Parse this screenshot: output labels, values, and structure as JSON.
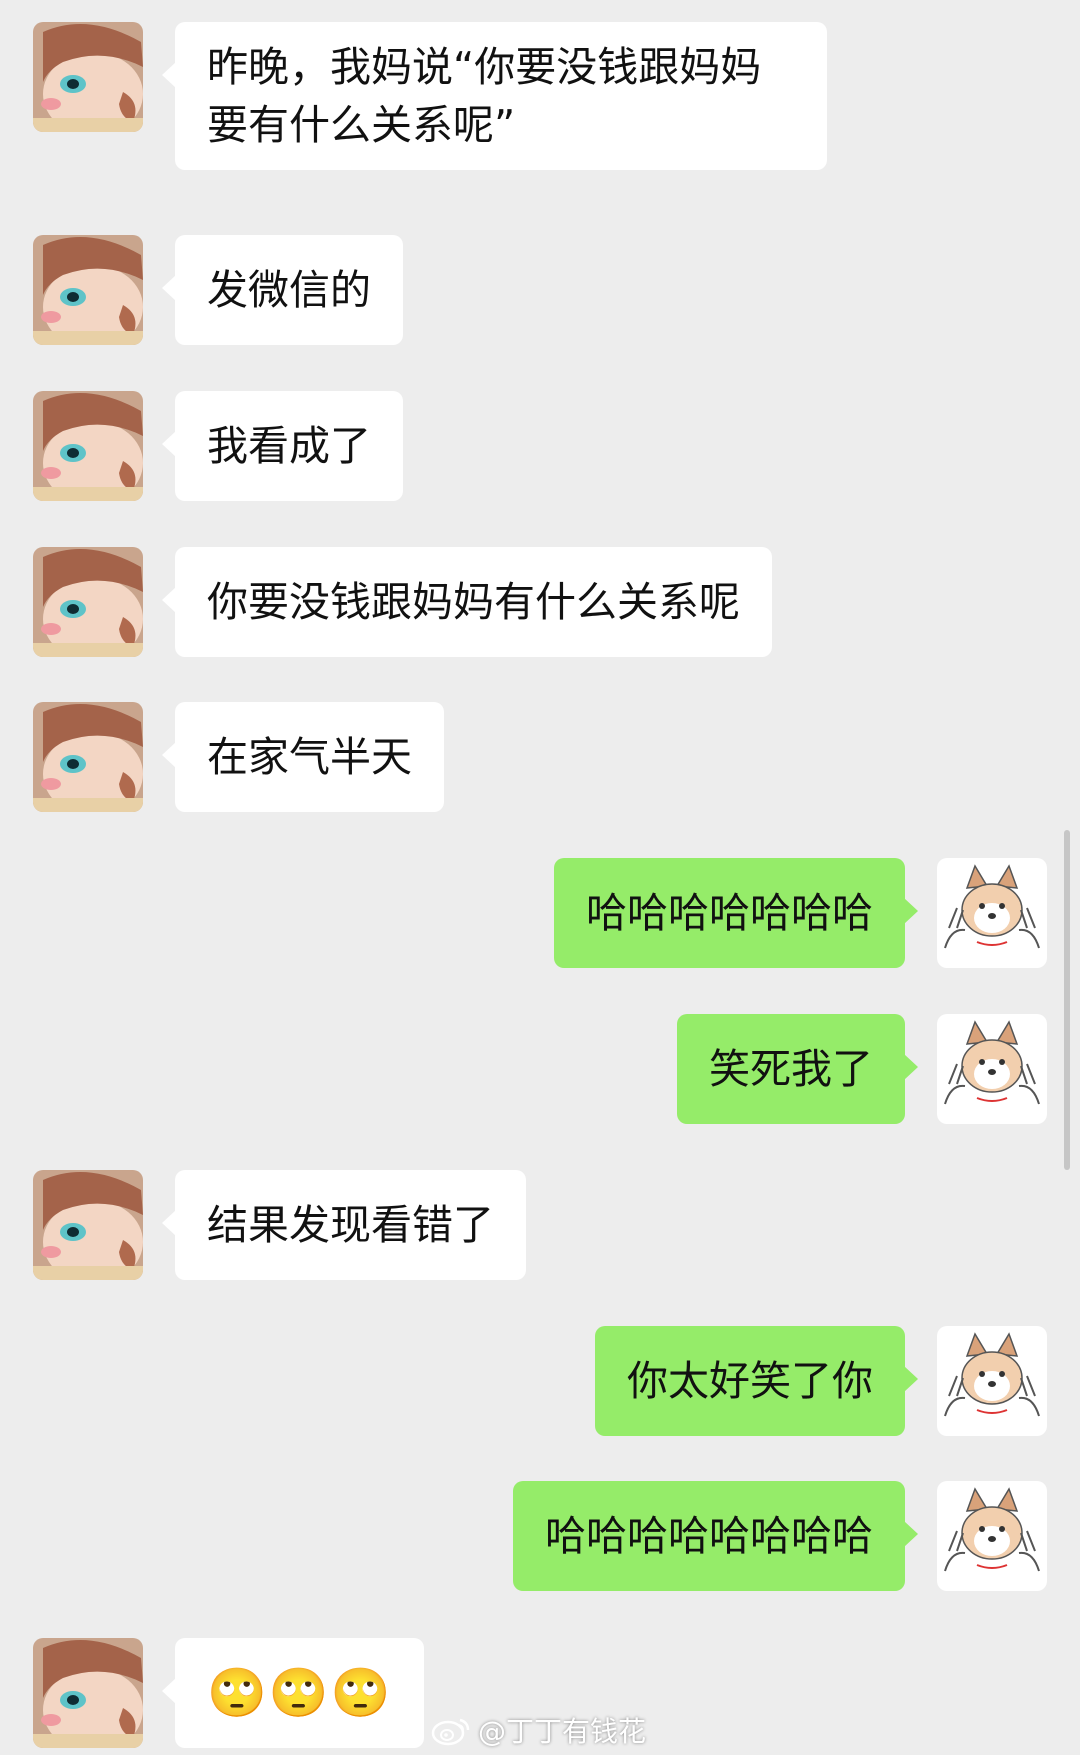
{
  "messages": [
    {
      "side": "left",
      "text": "昨晚，我妈说“你要没钱跟妈妈要有什么关系呢”"
    },
    {
      "side": "left",
      "text": "发微信的"
    },
    {
      "side": "left",
      "text": "我看成了"
    },
    {
      "side": "left",
      "text": "你要没钱跟妈妈有什么关系呢"
    },
    {
      "side": "left",
      "text": "在家气半天"
    },
    {
      "side": "right",
      "text": "哈哈哈哈哈哈哈"
    },
    {
      "side": "right",
      "text": "笑死我了"
    },
    {
      "side": "left",
      "text": "结果发现看错了"
    },
    {
      "side": "right",
      "text": "你太好笑了你"
    },
    {
      "side": "right",
      "text": "哈哈哈哈哈哈哈哈"
    },
    {
      "side": "left",
      "text": "🙄🙄🙄"
    }
  ],
  "watermark": {
    "text": "@丁丁有钱花"
  },
  "colors": {
    "background": "#ededed",
    "incoming_bubble": "#ffffff",
    "outgoing_bubble": "#95ec69"
  },
  "icons": {
    "left_avatar": "cartoon-girl-avatar",
    "right_avatar": "shiba-dog-avatar",
    "watermark": "weibo-icon"
  }
}
